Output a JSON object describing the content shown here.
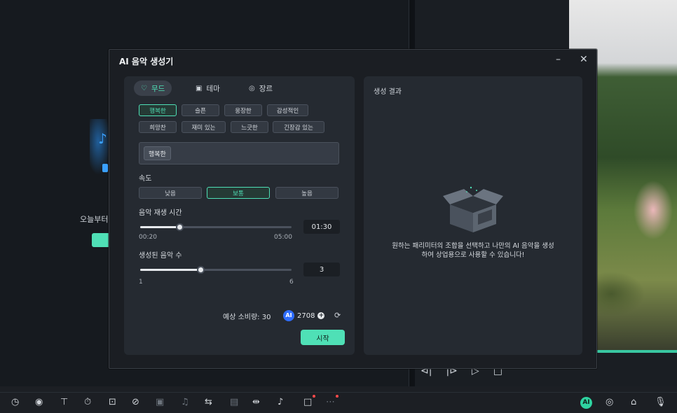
{
  "background": {
    "promo_text": "오늘부터",
    "preview_controls": [
      "⊲|",
      "|⊳",
      "▷",
      "□"
    ]
  },
  "dialog": {
    "title": "AI 음악 생성기",
    "minimize": "–",
    "close": "✕",
    "tabs": [
      {
        "label": "무드",
        "icon": "mood-icon",
        "active": true
      },
      {
        "label": "테마",
        "icon": "theme-icon",
        "active": false
      },
      {
        "label": "장르",
        "icon": "genre-icon",
        "active": false
      }
    ],
    "mood_chips": [
      {
        "label": "행복한",
        "active": true
      },
      {
        "label": "슬픈",
        "active": false
      },
      {
        "label": "웅장한",
        "active": false
      },
      {
        "label": "감성적인",
        "active": false
      },
      {
        "label": "희망찬",
        "active": false
      },
      {
        "label": "재미 있는",
        "active": false
      },
      {
        "label": "느긋한",
        "active": false
      },
      {
        "label": "긴장감 있는",
        "active": false
      }
    ],
    "selected_chip": "행복한",
    "speed": {
      "label": "속도",
      "options": [
        {
          "label": "낮음",
          "active": false
        },
        {
          "label": "보통",
          "active": true
        },
        {
          "label": "높음",
          "active": false
        }
      ]
    },
    "duration": {
      "label": "음악 재생 시간",
      "min": "00:20",
      "max": "05:00",
      "value": "01:30",
      "fraction": 0.26
    },
    "count": {
      "label": "생성된 음악 수",
      "min": "1",
      "max": "6",
      "value": "3",
      "fraction": 0.4
    },
    "cost_label": "예상 소비량: 30",
    "credits": "2708",
    "start_label": "시작",
    "result": {
      "title": "생성 결과",
      "message": "원하는 패리미터의 조합을 선택하고 나만의 AI 음악을 생성하여 상업용으로 사용할 수 있습니다!"
    }
  },
  "colors": {
    "accent": "#4fe0b6",
    "dialog_bg": "#1b1e23",
    "card_bg": "#252a31"
  }
}
